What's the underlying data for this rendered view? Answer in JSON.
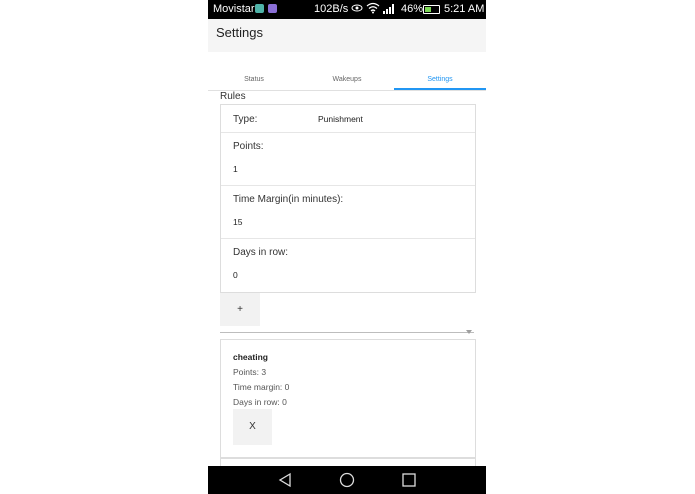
{
  "status_bar": {
    "carrier": "Movistar",
    "net_speed": "102B/s",
    "battery_percent": "46%",
    "time": "5:21 AM"
  },
  "app_bar": {
    "title": "Settings"
  },
  "tabs": [
    {
      "label": "Status"
    },
    {
      "label": "Wakeups"
    },
    {
      "label": "Settings",
      "active": true
    }
  ],
  "rules": {
    "title": "Rules",
    "form": {
      "type_label": "Type:",
      "type_value": "Punishment",
      "points_label": "Points:",
      "points_value": "1",
      "margin_label": "Time Margin(in minutes):",
      "margin_value": "15",
      "days_label": "Days in row:",
      "days_value": "0"
    },
    "add_label": "+",
    "items": [
      {
        "name": "cheating",
        "points": "Points: 3",
        "margin": "Time margin: 0",
        "days": "Days in row: 0",
        "remove_label": "X"
      }
    ]
  },
  "colors": {
    "accent": "#2196f3",
    "statusbar": "#000000",
    "navbar": "#000000"
  }
}
